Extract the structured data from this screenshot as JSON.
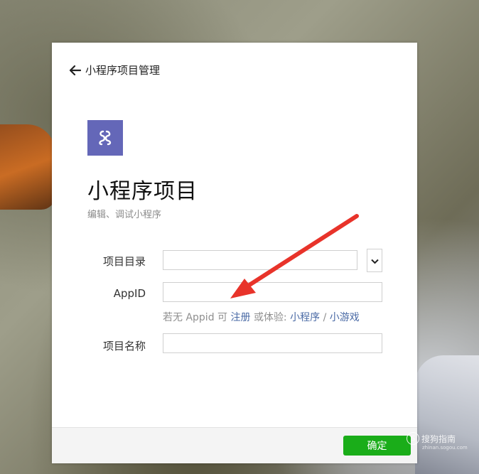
{
  "header": {
    "back_label": "小程序项目管理"
  },
  "project": {
    "title": "小程序项目",
    "subtitle": "编辑、调试小程序",
    "logo_color": "#6467b8"
  },
  "form": {
    "dir_label": "项目目录",
    "dir_value": "",
    "appid_label": "AppID",
    "appid_value": "",
    "name_label": "项目名称",
    "name_value": ""
  },
  "hint": {
    "prefix": "若无 Appid 可",
    "register": "注册",
    "middle": "或体验:",
    "mini_program": "小程序",
    "separator": "/",
    "mini_game": "小游戏"
  },
  "footer": {
    "confirm_label": "确定",
    "confirm_color": "#1aad19"
  },
  "watermark": {
    "brand": "搜狗指南",
    "url": "zhinan.sogou.com"
  },
  "icons": [
    "arrow-left-icon",
    "mini-program-logo-icon",
    "chevron-down-icon",
    "red-annotation-arrow"
  ]
}
